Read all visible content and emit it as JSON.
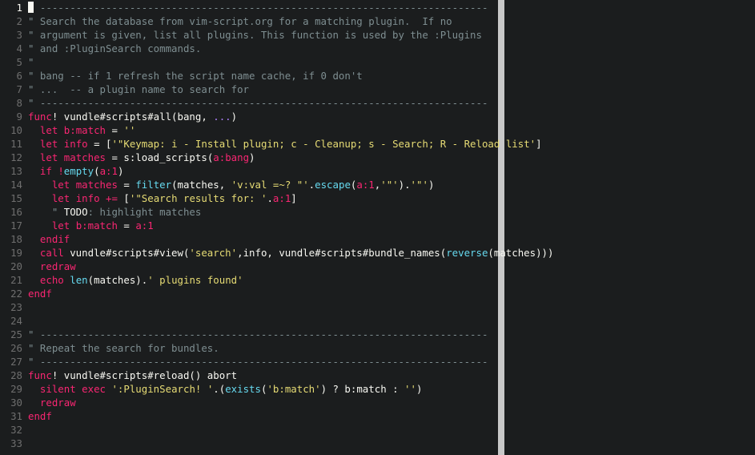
{
  "editor": {
    "name": "vim",
    "current_line": 1,
    "lines": [
      {
        "n": "1",
        "tokens": [
          {
            "t": "\" ---------------------------------------------------------------------------",
            "c": "t-comment"
          }
        ]
      },
      {
        "n": "2",
        "tokens": [
          {
            "t": "\" Search the database from vim-script.org for a matching plugin.  If no",
            "c": "t-comment"
          }
        ]
      },
      {
        "n": "3",
        "tokens": [
          {
            "t": "\" argument is given, list all plugins. This function is used by the :Plugins",
            "c": "t-comment"
          }
        ]
      },
      {
        "n": "4",
        "tokens": [
          {
            "t": "\" and :PluginSearch commands.",
            "c": "t-comment"
          }
        ]
      },
      {
        "n": "5",
        "tokens": [
          {
            "t": "\"",
            "c": "t-comment"
          }
        ]
      },
      {
        "n": "6",
        "tokens": [
          {
            "t": "\" bang -- if 1 refresh the script name cache, if 0 don't",
            "c": "t-comment"
          }
        ]
      },
      {
        "n": "7",
        "tokens": [
          {
            "t": "\" ...  -- a plugin name to search for",
            "c": "t-comment"
          }
        ]
      },
      {
        "n": "8",
        "tokens": [
          {
            "t": "\" ---------------------------------------------------------------------------",
            "c": "t-comment"
          }
        ]
      },
      {
        "n": "9",
        "tokens": [
          {
            "t": "func",
            "c": "t-kw"
          },
          {
            "t": "! vundle#scripts#all(bang, ",
            "c": "t-plain"
          },
          {
            "t": "...",
            "c": "t-num"
          },
          {
            "t": ")",
            "c": "t-plain"
          }
        ]
      },
      {
        "n": "10",
        "tokens": [
          {
            "t": "  ",
            "c": "t-plain"
          },
          {
            "t": "let",
            "c": "t-kw"
          },
          {
            "t": " ",
            "c": "t-plain"
          },
          {
            "t": "b:match",
            "c": "t-kw"
          },
          {
            "t": " = ",
            "c": "t-plain"
          },
          {
            "t": "''",
            "c": "t-str"
          }
        ]
      },
      {
        "n": "11",
        "tokens": [
          {
            "t": "  ",
            "c": "t-plain"
          },
          {
            "t": "let",
            "c": "t-kw"
          },
          {
            "t": " ",
            "c": "t-plain"
          },
          {
            "t": "info",
            "c": "t-kw"
          },
          {
            "t": " = [",
            "c": "t-plain"
          },
          {
            "t": "'\"Keymap: i - Install plugin; c - Cleanup; s - Search; R - Reload list'",
            "c": "t-str"
          },
          {
            "t": "]",
            "c": "t-plain"
          }
        ]
      },
      {
        "n": "12",
        "tokens": [
          {
            "t": "  ",
            "c": "t-plain"
          },
          {
            "t": "let",
            "c": "t-kw"
          },
          {
            "t": " ",
            "c": "t-plain"
          },
          {
            "t": "matches",
            "c": "t-kw"
          },
          {
            "t": " = s:load_scripts(",
            "c": "t-plain"
          },
          {
            "t": "a:bang",
            "c": "t-kw"
          },
          {
            "t": ")",
            "c": "t-plain"
          }
        ]
      },
      {
        "n": "13",
        "tokens": [
          {
            "t": "  ",
            "c": "t-plain"
          },
          {
            "t": "if",
            "c": "t-kw"
          },
          {
            "t": " ",
            "c": "t-plain"
          },
          {
            "t": "!",
            "c": "t-op"
          },
          {
            "t": "empty",
            "c": "t-fn"
          },
          {
            "t": "(",
            "c": "t-plain"
          },
          {
            "t": "a:1",
            "c": "t-kw"
          },
          {
            "t": ")",
            "c": "t-plain"
          }
        ]
      },
      {
        "n": "14",
        "tokens": [
          {
            "t": "    ",
            "c": "t-plain"
          },
          {
            "t": "let",
            "c": "t-kw"
          },
          {
            "t": " ",
            "c": "t-plain"
          },
          {
            "t": "matches",
            "c": "t-kw"
          },
          {
            "t": " = ",
            "c": "t-plain"
          },
          {
            "t": "filter",
            "c": "t-fn"
          },
          {
            "t": "(matches, ",
            "c": "t-plain"
          },
          {
            "t": "'v:val =~? \"'",
            "c": "t-str"
          },
          {
            "t": ".",
            "c": "t-plain"
          },
          {
            "t": "escape",
            "c": "t-fn"
          },
          {
            "t": "(",
            "c": "t-plain"
          },
          {
            "t": "a:1",
            "c": "t-kw"
          },
          {
            "t": ",",
            "c": "t-plain"
          },
          {
            "t": "'\"'",
            "c": "t-str"
          },
          {
            "t": ").",
            "c": "t-plain"
          },
          {
            "t": "'\"'",
            "c": "t-str"
          },
          {
            "t": ")",
            "c": "t-plain"
          }
        ]
      },
      {
        "n": "15",
        "tokens": [
          {
            "t": "    ",
            "c": "t-plain"
          },
          {
            "t": "let",
            "c": "t-kw"
          },
          {
            "t": " ",
            "c": "t-plain"
          },
          {
            "t": "info",
            "c": "t-kw"
          },
          {
            "t": " ",
            "c": "t-plain"
          },
          {
            "t": "+=",
            "c": "t-op"
          },
          {
            "t": " [",
            "c": "t-plain"
          },
          {
            "t": "'\"Search results for: '",
            "c": "t-str"
          },
          {
            "t": ".",
            "c": "t-plain"
          },
          {
            "t": "a:1",
            "c": "t-kw"
          },
          {
            "t": "]",
            "c": "t-plain"
          }
        ]
      },
      {
        "n": "16",
        "tokens": [
          {
            "t": "    ",
            "c": "t-plain"
          },
          {
            "t": "\" ",
            "c": "t-comment"
          },
          {
            "t": "TODO",
            "c": "t-todo"
          },
          {
            "t": ": highlight matches",
            "c": "t-comment"
          }
        ]
      },
      {
        "n": "17",
        "tokens": [
          {
            "t": "    ",
            "c": "t-plain"
          },
          {
            "t": "let",
            "c": "t-kw"
          },
          {
            "t": " ",
            "c": "t-plain"
          },
          {
            "t": "b:match",
            "c": "t-kw"
          },
          {
            "t": " = ",
            "c": "t-plain"
          },
          {
            "t": "a:1",
            "c": "t-kw"
          }
        ]
      },
      {
        "n": "18",
        "tokens": [
          {
            "t": "  ",
            "c": "t-plain"
          },
          {
            "t": "endif",
            "c": "t-kw"
          }
        ]
      },
      {
        "n": "19",
        "tokens": [
          {
            "t": "  ",
            "c": "t-plain"
          },
          {
            "t": "call",
            "c": "t-kw"
          },
          {
            "t": " vundle#scripts#view(",
            "c": "t-plain"
          },
          {
            "t": "'search'",
            "c": "t-str"
          },
          {
            "t": ",info, vundle#scripts#bundle_names(",
            "c": "t-plain"
          },
          {
            "t": "reverse",
            "c": "t-fn"
          },
          {
            "t": "(matches)))",
            "c": "t-plain"
          }
        ]
      },
      {
        "n": "20",
        "tokens": [
          {
            "t": "  ",
            "c": "t-plain"
          },
          {
            "t": "redraw",
            "c": "t-kw"
          }
        ]
      },
      {
        "n": "21",
        "tokens": [
          {
            "t": "  ",
            "c": "t-plain"
          },
          {
            "t": "echo",
            "c": "t-kw"
          },
          {
            "t": " ",
            "c": "t-plain"
          },
          {
            "t": "len",
            "c": "t-fn"
          },
          {
            "t": "(matches).",
            "c": "t-plain"
          },
          {
            "t": "' plugins found'",
            "c": "t-str"
          }
        ]
      },
      {
        "n": "22",
        "tokens": [
          {
            "t": "endf",
            "c": "t-kw"
          }
        ]
      },
      {
        "n": "23",
        "tokens": []
      },
      {
        "n": "24",
        "tokens": []
      },
      {
        "n": "25",
        "tokens": [
          {
            "t": "\" ---------------------------------------------------------------------------",
            "c": "t-comment"
          }
        ]
      },
      {
        "n": "26",
        "tokens": [
          {
            "t": "\" Repeat the search for bundles.",
            "c": "t-comment"
          }
        ]
      },
      {
        "n": "27",
        "tokens": [
          {
            "t": "\" ---------------------------------------------------------------------------",
            "c": "t-comment"
          }
        ]
      },
      {
        "n": "28",
        "tokens": [
          {
            "t": "func",
            "c": "t-kw"
          },
          {
            "t": "! vundle#scripts#reload() abort",
            "c": "t-plain"
          }
        ]
      },
      {
        "n": "29",
        "tokens": [
          {
            "t": "  ",
            "c": "t-plain"
          },
          {
            "t": "silent",
            "c": "t-kw"
          },
          {
            "t": " ",
            "c": "t-plain"
          },
          {
            "t": "exec",
            "c": "t-kw"
          },
          {
            "t": " ",
            "c": "t-plain"
          },
          {
            "t": "':PluginSearch! '",
            "c": "t-str"
          },
          {
            "t": ".(",
            "c": "t-plain"
          },
          {
            "t": "exists",
            "c": "t-fn"
          },
          {
            "t": "(",
            "c": "t-plain"
          },
          {
            "t": "'b:match'",
            "c": "t-str"
          },
          {
            "t": ") ? b:match : ",
            "c": "t-plain"
          },
          {
            "t": "''",
            "c": "t-str"
          },
          {
            "t": ")",
            "c": "t-plain"
          }
        ]
      },
      {
        "n": "30",
        "tokens": [
          {
            "t": "  ",
            "c": "t-plain"
          },
          {
            "t": "redraw",
            "c": "t-kw"
          }
        ]
      },
      {
        "n": "31",
        "tokens": [
          {
            "t": "endf",
            "c": "t-kw"
          }
        ]
      },
      {
        "n": "32",
        "tokens": []
      },
      {
        "n": "33",
        "tokens": []
      }
    ]
  }
}
